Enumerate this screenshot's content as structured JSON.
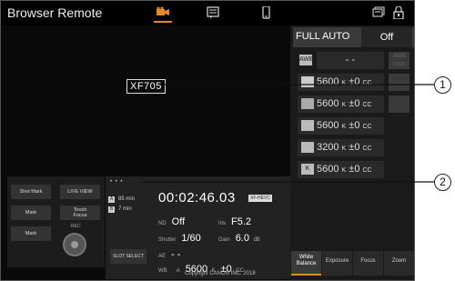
{
  "header": {
    "title": "Browser Remote",
    "icons": [
      "camera-icon",
      "metadata-icon",
      "phone-icon",
      "record-review-icon",
      "lock-icon"
    ]
  },
  "callouts": {
    "model_label": "XF705",
    "number_1": "1",
    "number_2": "2"
  },
  "white_balance": {
    "full_auto_label": "FULL AUTO",
    "full_auto_value": "Off",
    "awb_icon": "AWB",
    "awb_value": "- -",
    "awb_lock_label": "AWB\nLock",
    "rows": [
      {
        "icon": "Set A",
        "temp": "5600",
        "unit": "K",
        "cc": "±0",
        "cc_unit": "CC"
      },
      {
        "icon": "Set B",
        "temp": "5600",
        "unit": "K",
        "cc": "±0",
        "cc_unit": "CC"
      },
      {
        "icon": "Daylight",
        "temp": "5600",
        "unit": "K",
        "cc": "±0",
        "cc_unit": "CC"
      },
      {
        "icon": "Tungsten",
        "temp": "3200",
        "unit": "K",
        "cc": "±0",
        "cc_unit": "CC"
      },
      {
        "icon": "K",
        "temp": "5600",
        "unit": "K",
        "cc": "±0",
        "cc_unit": "CC"
      }
    ]
  },
  "tabs": [
    {
      "label": "White\nBalance",
      "active": true
    },
    {
      "label": "Exposure",
      "active": false
    },
    {
      "label": "Focus",
      "active": false
    },
    {
      "label": "Zoom",
      "active": false
    }
  ],
  "controls": {
    "shot_mark": "Shot Mark",
    "live_view": "LIVE VIEW",
    "mark1": "Mark",
    "touch_focus": "Touch\nFocus",
    "mark2": "Mark",
    "rec": "REC"
  },
  "status": {
    "dots": "• • •",
    "media_a_label": "A",
    "media_a_value": "85 min",
    "media_b_label": "B",
    "media_b_value": "7 min",
    "slot_select": "SLOT SELECT",
    "timecode": "00:02:46.03",
    "codec": "XF-HEVC",
    "nd_label": "ND",
    "nd_value": "Off",
    "iris_label": "Iris",
    "iris_value": "F5.2",
    "shutter_label": "Shutter",
    "shutter_value": "1/60",
    "gain_label": "Gain",
    "gain_value": "6.0",
    "gain_unit": "dB",
    "ae_label": "AE",
    "ae_value": "- -",
    "wb_label": "WB",
    "wb_icon": "A",
    "wb_temp": "5600",
    "wb_unit": "K",
    "wb_cc": "±0",
    "wb_cc_unit": "CC"
  },
  "copyright": "Copyright CANON INC. 2018"
}
